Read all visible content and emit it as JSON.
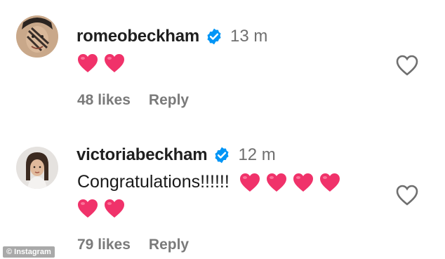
{
  "comments": [
    {
      "username": "romeobeckham",
      "time": "13 m",
      "text": "",
      "hearts_line1": 2,
      "hearts_line2": 0,
      "likes": "48 likes",
      "reply": "Reply"
    },
    {
      "username": "victoriabeckham",
      "time": "12 m",
      "text": "Congratulations!!!!!!",
      "hearts_line1": 4,
      "hearts_line2": 2,
      "likes": "79 likes",
      "reply": "Reply"
    }
  ],
  "watermark": "© Instagram",
  "colors": {
    "heart": "#f0326a",
    "verified": "#0095f6",
    "meta_text": "#7a7a7a"
  },
  "icons": {
    "verified": "verified-badge-icon",
    "heart": "heart-emoji-icon",
    "like": "heart-outline-icon"
  }
}
